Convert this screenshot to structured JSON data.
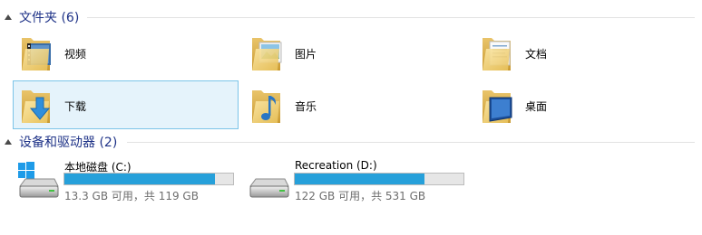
{
  "groups": {
    "folders": {
      "title": "文件夹 (6)"
    },
    "devices": {
      "title": "设备和驱动器 (2)"
    }
  },
  "folders": [
    {
      "label": "视频",
      "icon": "video-folder-icon"
    },
    {
      "label": "图片",
      "icon": "pictures-folder-icon"
    },
    {
      "label": "文档",
      "icon": "documents-folder-icon"
    },
    {
      "label": "下载",
      "icon": "downloads-folder-icon",
      "selected": true
    },
    {
      "label": "音乐",
      "icon": "music-folder-icon"
    },
    {
      "label": "桌面",
      "icon": "desktop-folder-icon"
    }
  ],
  "drives": [
    {
      "name": "本地磁盘 (C:)",
      "info": "13.3 GB 可用，共 119 GB",
      "used_fraction": 0.89,
      "icon": "system-drive-icon"
    },
    {
      "name": "Recreation (D:)",
      "info": "122 GB 可用，共 531 GB",
      "used_fraction": 0.77,
      "icon": "hard-drive-icon"
    }
  ],
  "colors": {
    "header_text": "#1e3287",
    "selection_bg": "#e5f3fb",
    "selection_border": "#7bc4e8",
    "bar_fill": "#26a0da"
  }
}
